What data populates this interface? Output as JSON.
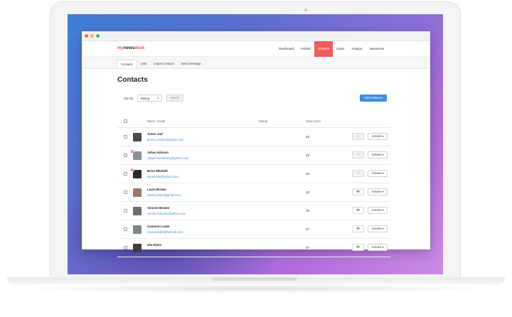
{
  "brand": {
    "logo_my": "my",
    "logo_news": "news",
    "logo_desk": "desk",
    "accent": "#f25c5c",
    "link_color": "#3d8fe0"
  },
  "nav": {
    "items": [
      {
        "label": "Dashboard",
        "active": false
      },
      {
        "label": "Publish",
        "active": false
      },
      {
        "label": "Network",
        "active": true
      },
      {
        "label": "Listen",
        "active": false
      },
      {
        "label": "Analyze",
        "active": false
      },
      {
        "label": "Newsroom",
        "active": false
      }
    ]
  },
  "tabs": [
    {
      "label": "Contacts",
      "active": true
    },
    {
      "label": "Lists",
      "active": false
    },
    {
      "label": "Import contacts",
      "active": false
    },
    {
      "label": "Send message",
      "active": false
    }
  ],
  "page": {
    "title": "Contacts"
  },
  "toolbar": {
    "sort_label": "Sort by",
    "sort_value": "Rating",
    "delete_label": "Delete",
    "add_label": "Add Contact"
  },
  "table": {
    "headers": {
      "name_email": "Name / Email",
      "rating": "Rating",
      "klout": "Klout score"
    },
    "actions_label": "Actions",
    "rows": [
      {
        "name": "Anton Jarl",
        "email": "jerome_bratus@yahoo.com",
        "score": "42",
        "blocked": false,
        "mail_enabled": false,
        "avatar_color": "#4a4a4a"
      },
      {
        "name": "Johan Nilsson",
        "email": "casper.bretonberg@yahoo.com",
        "score": "43",
        "blocked": true,
        "mail_enabled": false,
        "avatar_color": "#8a8f96"
      },
      {
        "name": "Brise Mitchell",
        "email": "kirjola.ruin@yahoo.com",
        "score": "43",
        "blocked": true,
        "mail_enabled": false,
        "avatar_color": "#2b2b2b"
      },
      {
        "name": "Laura Brown",
        "email": "wesley.kutsu@gmail.com",
        "score": "12",
        "blocked": false,
        "mail_enabled": true,
        "avatar_color": "#9a7b6a"
      },
      {
        "name": "Vincent Becker",
        "email": "christa.schumm@yahoo.com",
        "score": "75",
        "blocked": false,
        "mail_enabled": true,
        "avatar_color": "#6d6d6d"
      },
      {
        "name": "Cameron Lowe",
        "email": "ostia.windler@hotmail.com",
        "score": "47",
        "blocked": false,
        "mail_enabled": true,
        "avatar_color": "#7b8a7a"
      },
      {
        "name": "Ola Hicks",
        "email": "",
        "score": "47",
        "blocked": false,
        "mail_enabled": true,
        "avatar_color": "#3c3c3c"
      }
    ]
  }
}
